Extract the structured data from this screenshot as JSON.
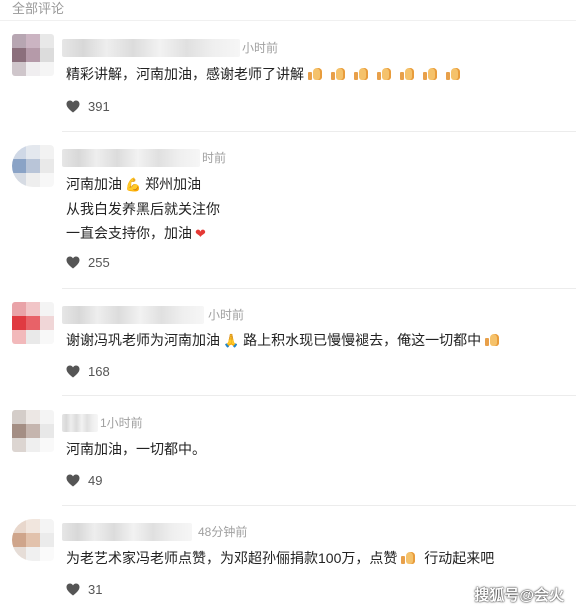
{
  "section_title": "全部评论",
  "watermark": "搜狐号@会火",
  "comments": [
    {
      "time": "小时前",
      "lines": [
        "精彩讲解，河南加油，感谢老师了讲解"
      ],
      "likes": "391",
      "avatar_colors": [
        "#b7a6b2",
        "#cbb4c2",
        "#e8e8e8",
        "#8b6f7c",
        "#b59aa9",
        "#dcdcdc",
        "#cfc6cb",
        "#f0eef0",
        "#f5f5f5"
      ]
    },
    {
      "time": "时前",
      "lines": [
        "河南加油",
        "郑州加油",
        "从我白发养黑后就关注你",
        "一直会支持你，加油"
      ],
      "likes": "255",
      "avatar_colors": [
        "#cfd8e6",
        "#e4e8ee",
        "#f2f2f2",
        "#8aa3c6",
        "#b9c5d8",
        "#e9e9e9",
        "#d6dbe3",
        "#eeeeee",
        "#f7f7f7"
      ]
    },
    {
      "time": "小时前",
      "lines": [
        "谢谢冯巩老师为河南加油",
        "路上积水现已慢慢褪去，俺这一切都中"
      ],
      "likes": "168",
      "avatar_colors": [
        "#e9a3a8",
        "#f1c5c7",
        "#f4f4f4",
        "#e03a41",
        "#e86268",
        "#f0d6d7",
        "#f2b9bb",
        "#e9e9e9",
        "#f8f8f8"
      ]
    },
    {
      "time": "1小时前",
      "lines": [
        "河南加油，一切都中。"
      ],
      "likes": "49",
      "avatar_colors": [
        "#d4cdc9",
        "#ece7e4",
        "#f4f4f4",
        "#a48e84",
        "#c5b5ae",
        "#e8e8e8",
        "#dcd5d1",
        "#efefef",
        "#f9f9f9"
      ]
    },
    {
      "time": "48分钟前",
      "lines": [
        "为老艺术家冯老师点赞，为邓超孙俪捐款100万，点赞",
        "行动起来吧"
      ],
      "likes": "31",
      "avatar_colors": [
        "#e8d7cc",
        "#f1e6de",
        "#f4f4f4",
        "#cfa58b",
        "#e2c2ac",
        "#ebebeb",
        "#e6ddd7",
        "#f0f0f0",
        "#fafafa"
      ]
    }
  ]
}
